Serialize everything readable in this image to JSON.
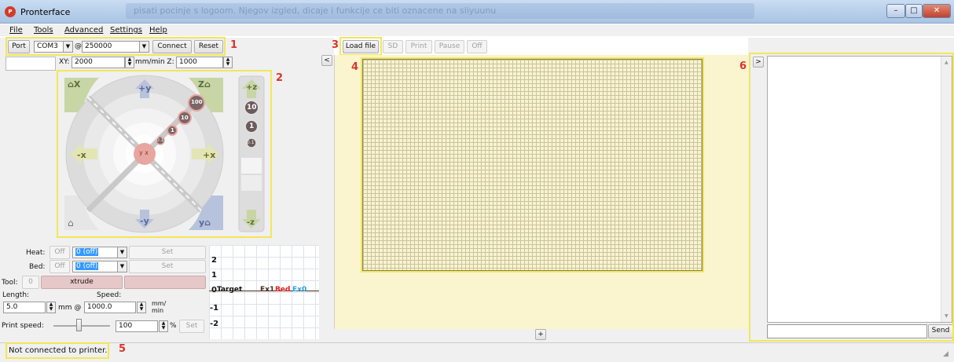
{
  "window": {
    "title": "Pronterface",
    "app_icon": "pronterface-logo",
    "blurred_title": "pisati pocinje s logoom. Njegov izgled, dicaje i funkcije ce biti oznacene na sliyuunu"
  },
  "menu": [
    "File",
    "Tools",
    "Advanced",
    "Settings",
    "Help"
  ],
  "connection": {
    "port_label": "Port",
    "port_value": "COM3",
    "at": "@",
    "baud_value": "250000",
    "connect_label": "Connect",
    "reset_label": "Reset"
  },
  "feed": {
    "xy_label": "XY:",
    "xy_value": "2000",
    "unit_label": "mm/min Z:",
    "z_value": "1000"
  },
  "jog": {
    "home_x": "X",
    "home_z": "Z",
    "plus_y": "+y",
    "minus_y": "-y",
    "minus_x": "-x",
    "plus_x": "+x",
    "home_y": "y",
    "plus_z": "+z",
    "minus_z": "-z",
    "center_label": "y x",
    "steps_xy": [
      "100",
      "10",
      "1",
      "0.1"
    ],
    "steps_z": [
      "10",
      "1",
      "0.1"
    ]
  },
  "temps": {
    "heat_label": "Heat:",
    "heat_off": "Off",
    "heat_value": "0 (off)",
    "heat_set": "Set",
    "bed_label": "Bed:",
    "bed_off": "Off",
    "bed_value": "0 (off)",
    "bed_set": "Set"
  },
  "tool": {
    "tool_label": "Tool:",
    "tool_value": "0",
    "extrude_label": "xtrude"
  },
  "extrude": {
    "length_label": "Length:",
    "speed_label": "Speed:",
    "length_value": "5.0",
    "mm_at": "mm @",
    "speed_value": "1000.0",
    "speed_unit_top": "mm/",
    "speed_unit_bottom": "min"
  },
  "print_speed": {
    "label": "Print speed:",
    "value": "100",
    "unit": "%",
    "set_label": "Set",
    "slider_value": 0.45
  },
  "graph": {
    "y_ticks": [
      "2",
      "1",
      "0",
      "-1",
      "-2"
    ],
    "legend_target": "Target",
    "legend_ex1": "Ex1",
    "legend_bed": "Bed",
    "legend_ex0": "Ex0",
    "colors": {
      "ex1": "#4a2a1a",
      "bed": "#e02020",
      "ex0": "#2aa0d8"
    }
  },
  "toolbar": {
    "load_file": "Load file",
    "sd": "SD",
    "print": "Print",
    "pause": "Pause",
    "off": "Off"
  },
  "collapse": {
    "left_arrow": "<",
    "right_arrow": ">",
    "add": "+"
  },
  "console": {
    "send_label": "Send"
  },
  "status": {
    "text": "Not connected to printer."
  },
  "annotations": [
    "1",
    "2",
    "3",
    "4",
    "5",
    "6"
  ],
  "colors": {
    "highlight": "#f3e65a",
    "annotation": "#d9352a",
    "grid_bg": "#f8f3d2",
    "panel_bg": "#faf5cf"
  }
}
